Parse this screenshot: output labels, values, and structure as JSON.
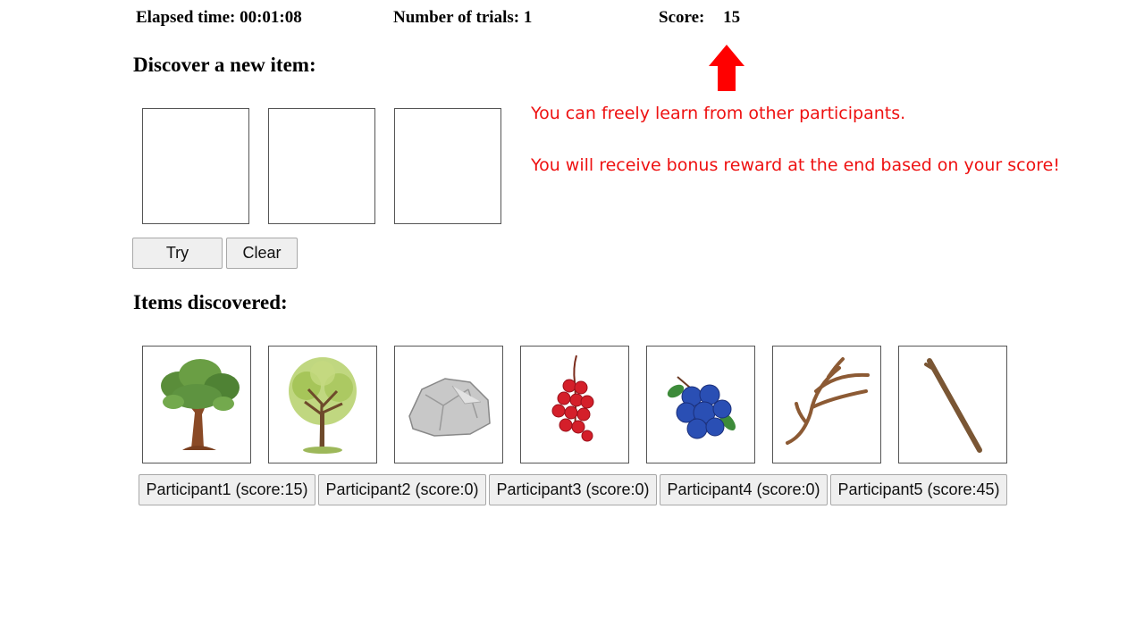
{
  "status_bar": {
    "elapsed_label": "Elapsed time:",
    "elapsed_value": "00:01:08",
    "trials_label": "Number of trials:",
    "trials_value": "1",
    "score_label": "Score:",
    "score_value": "15"
  },
  "discover": {
    "heading": "Discover a new item:",
    "try_label": "Try",
    "clear_label": "Clear"
  },
  "annotation": {
    "line1": "You can freely learn from other participants.",
    "line2": "You will receive bonus reward at the end based on your score!",
    "color": "#ee1111"
  },
  "discovered": {
    "heading": "Items discovered:",
    "items": [
      {
        "icon": "oak-tree-icon"
      },
      {
        "icon": "young-tree-icon"
      },
      {
        "icon": "rock-icon"
      },
      {
        "icon": "red-currant-icon"
      },
      {
        "icon": "blueberry-icon"
      },
      {
        "icon": "antler-icon"
      },
      {
        "icon": "stick-icon"
      }
    ]
  },
  "participants": [
    {
      "label": "Participant1 (score:15)"
    },
    {
      "label": "Participant2 (score:0)"
    },
    {
      "label": "Participant3 (score:0)"
    },
    {
      "label": "Participant4 (score:0)"
    },
    {
      "label": "Participant5 (score:45)"
    }
  ]
}
